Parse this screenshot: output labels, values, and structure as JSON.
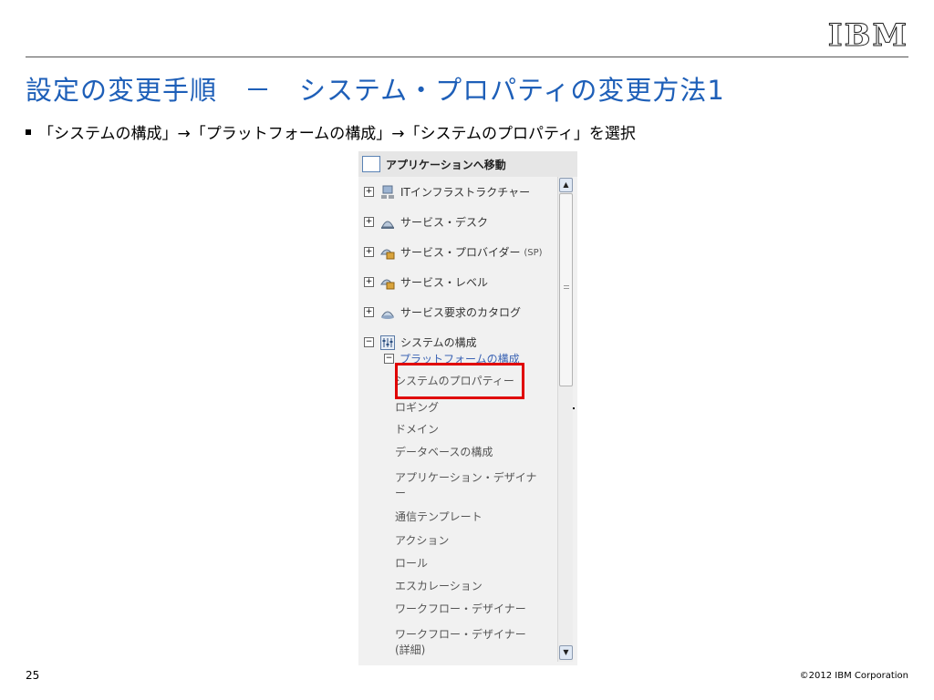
{
  "header": {
    "logo": "IBM",
    "title": "設定の変更手順　－　システム・プロパティの変更方法1"
  },
  "bullet": {
    "text": "「システムの構成」→「プラットフォームの構成」→「システムのプロパティ」を選択"
  },
  "panel": {
    "title": "アプリケーションへ移動",
    "tree": [
      {
        "label": "ITインフラストラクチャー",
        "icon": "computer-icon",
        "expander": "+"
      },
      {
        "label": "サービス・デスク",
        "icon": "service-bell-icon",
        "expander": "+"
      },
      {
        "label": "サービス・プロバイダー",
        "suffix": "(SP)",
        "icon": "provider-icon",
        "expander": "+"
      },
      {
        "label": "サービス・レベル",
        "icon": "service-level-icon",
        "expander": "+"
      },
      {
        "label": "サービス要求のカタログ",
        "icon": "catalog-icon",
        "expander": "+"
      },
      {
        "label": "システムの構成",
        "icon": "settings-sliders-icon",
        "expander": "−"
      }
    ],
    "platform": {
      "label": "プラットフォームの構成",
      "expander": "−"
    },
    "subitems": [
      "システムのプロパティー",
      "ロギング",
      "ドメイン",
      "データベースの構成",
      "アプリケーション・デザイナ",
      "ー",
      "通信テンプレート",
      "アクション",
      "ロール",
      "エスカレーション",
      "ワークフロー・デザイナー",
      "ワークフロー・デザイナー",
      "(詳細)"
    ],
    "scroll_up": "▲",
    "scroll_down": "▼"
  },
  "footer": {
    "page": "25",
    "copyright": "©2012 IBM Corporation"
  },
  "colors": {
    "title": "#1e5fb8",
    "highlight": "#e00000",
    "link": "#3c64b4"
  }
}
